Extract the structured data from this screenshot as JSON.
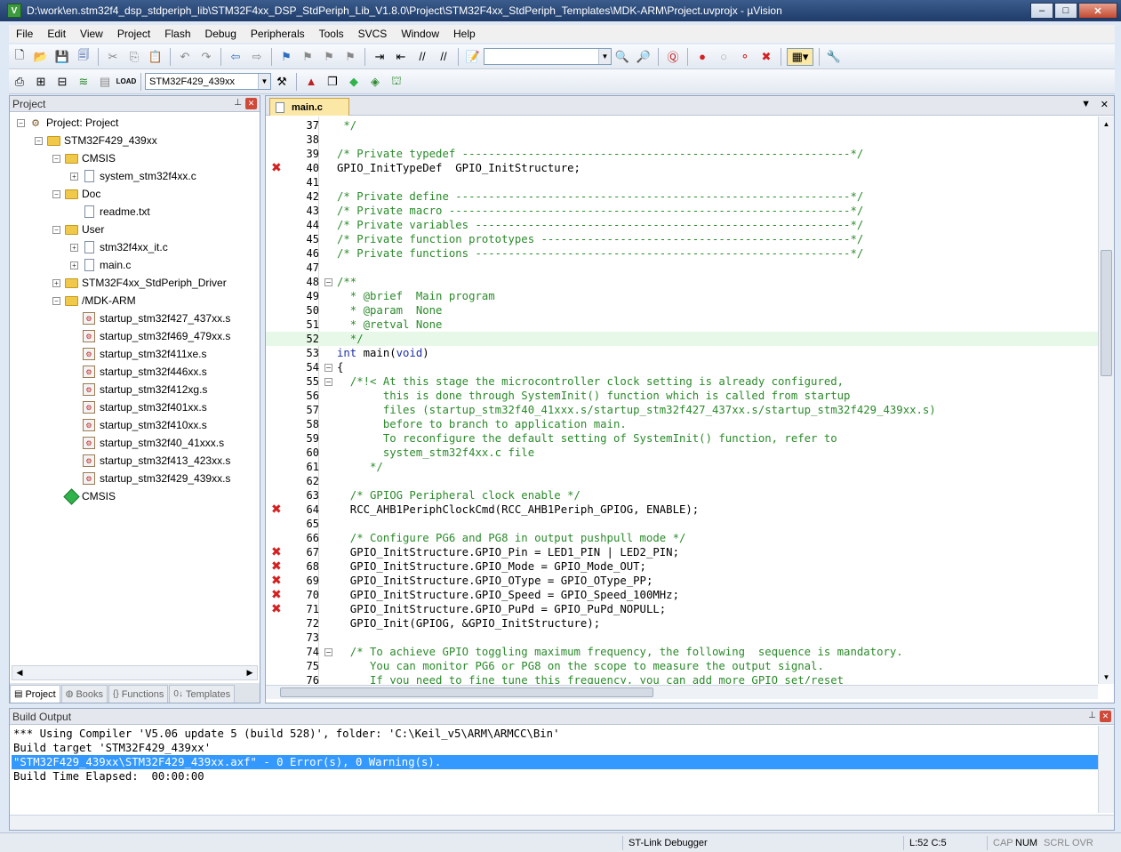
{
  "window": {
    "title": "D:\\work\\en.stm32f4_dsp_stdperiph_lib\\STM32F4xx_DSP_StdPeriph_Lib_V1.8.0\\Project\\STM32F4xx_StdPeriph_Templates\\MDK-ARM\\Project.uvprojx - µVision",
    "minimize": "–",
    "maximize": "□",
    "close": "✕"
  },
  "menu": [
    "File",
    "Edit",
    "View",
    "Project",
    "Flash",
    "Debug",
    "Peripherals",
    "Tools",
    "SVCS",
    "Window",
    "Help"
  ],
  "toolbar2": {
    "target_combo": "STM32F429_439xx",
    "load_label": "LOAD"
  },
  "project_panel": {
    "title": "Project",
    "pin": "📌",
    "close": "✕",
    "tree": [
      {
        "label": "Project: Project",
        "level": 0,
        "icon": "project-icon",
        "expander": "−"
      },
      {
        "label": "STM32F429_439xx",
        "level": 1,
        "icon": "folder-icon",
        "expander": "−"
      },
      {
        "label": "CMSIS",
        "level": 2,
        "icon": "folder-icon",
        "expander": "−"
      },
      {
        "label": "system_stm32f4xx.c",
        "level": 3,
        "icon": "file-icon",
        "expander": "+"
      },
      {
        "label": "Doc",
        "level": 2,
        "icon": "folder-icon",
        "expander": "−"
      },
      {
        "label": "readme.txt",
        "level": 3,
        "icon": "file-icon",
        "expander": ""
      },
      {
        "label": "User",
        "level": 2,
        "icon": "folder-icon",
        "expander": "−"
      },
      {
        "label": "stm32f4xx_it.c",
        "level": 3,
        "icon": "file-icon",
        "expander": "+"
      },
      {
        "label": "main.c",
        "level": 3,
        "icon": "file-icon",
        "expander": "+"
      },
      {
        "label": "STM32F4xx_StdPeriph_Driver",
        "level": 2,
        "icon": "folder-icon",
        "expander": "+"
      },
      {
        "label": "/MDK-ARM",
        "level": 2,
        "icon": "folder-icon",
        "expander": "−"
      },
      {
        "label": "startup_stm32f427_437xx.s",
        "level": 3,
        "icon": "asm-icon",
        "expander": ""
      },
      {
        "label": "startup_stm32f469_479xx.s",
        "level": 3,
        "icon": "asm-icon",
        "expander": ""
      },
      {
        "label": "startup_stm32f411xe.s",
        "level": 3,
        "icon": "asm-icon",
        "expander": ""
      },
      {
        "label": "startup_stm32f446xx.s",
        "level": 3,
        "icon": "asm-icon",
        "expander": ""
      },
      {
        "label": "startup_stm32f412xg.s",
        "level": 3,
        "icon": "asm-icon",
        "expander": ""
      },
      {
        "label": "startup_stm32f401xx.s",
        "level": 3,
        "icon": "asm-icon",
        "expander": ""
      },
      {
        "label": "startup_stm32f410xx.s",
        "level": 3,
        "icon": "asm-icon",
        "expander": ""
      },
      {
        "label": "startup_stm32f40_41xxx.s",
        "level": 3,
        "icon": "asm-icon",
        "expander": ""
      },
      {
        "label": "startup_stm32f413_423xx.s",
        "level": 3,
        "icon": "asm-icon",
        "expander": ""
      },
      {
        "label": "startup_stm32f429_439xx.s",
        "level": 3,
        "icon": "asm-icon",
        "expander": ""
      },
      {
        "label": "CMSIS",
        "level": 2,
        "icon": "cmsis-gem-icon",
        "expander": ""
      }
    ],
    "tabs": [
      {
        "label": "Project",
        "icon": "▤",
        "active": true
      },
      {
        "label": "Books",
        "icon": "◍",
        "active": false
      },
      {
        "label": "Functions",
        "icon": "{}",
        "active": false
      },
      {
        "label": "Templates",
        "icon": "0↓",
        "active": false
      }
    ]
  },
  "editor": {
    "tab_label": "main.c",
    "dropdown": "▼",
    "close": "✕",
    "lines": [
      {
        "n": "37",
        "text": " */",
        "type": "cmt",
        "err": false,
        "fold": ""
      },
      {
        "n": "38",
        "text": "",
        "type": "plain",
        "err": false,
        "fold": ""
      },
      {
        "n": "39",
        "text": "/* Private typedef -----------------------------------------------------------*/",
        "type": "cmt",
        "err": false,
        "fold": ""
      },
      {
        "n": "40",
        "text": "GPIO_InitTypeDef  GPIO_InitStructure;",
        "type": "plain",
        "err": true,
        "fold": ""
      },
      {
        "n": "41",
        "text": "",
        "type": "plain",
        "err": false,
        "fold": ""
      },
      {
        "n": "42",
        "text": "/* Private define ------------------------------------------------------------*/",
        "type": "cmt",
        "err": false,
        "fold": ""
      },
      {
        "n": "43",
        "text": "/* Private macro -------------------------------------------------------------*/",
        "type": "cmt",
        "err": false,
        "fold": ""
      },
      {
        "n": "44",
        "text": "/* Private variables ---------------------------------------------------------*/",
        "type": "cmt",
        "err": false,
        "fold": ""
      },
      {
        "n": "45",
        "text": "/* Private function prototypes -----------------------------------------------*/",
        "type": "cmt",
        "err": false,
        "fold": ""
      },
      {
        "n": "46",
        "text": "/* Private functions ---------------------------------------------------------*/",
        "type": "cmt",
        "err": false,
        "fold": ""
      },
      {
        "n": "47",
        "text": "",
        "type": "plain",
        "err": false,
        "fold": ""
      },
      {
        "n": "48",
        "text": "/**",
        "type": "cmt",
        "err": false,
        "fold": "−"
      },
      {
        "n": "49",
        "text": "  * @brief  Main program",
        "type": "cmt",
        "err": false,
        "fold": ""
      },
      {
        "n": "50",
        "text": "  * @param  None",
        "type": "cmt",
        "err": false,
        "fold": ""
      },
      {
        "n": "51",
        "text": "  * @retval None",
        "type": "cmt",
        "err": false,
        "fold": ""
      },
      {
        "n": "52",
        "text": "  */",
        "type": "cmt",
        "err": false,
        "fold": "",
        "current": true
      },
      {
        "n": "53",
        "text": "int main(void)",
        "type": "kw",
        "err": false,
        "fold": ""
      },
      {
        "n": "54",
        "text": "{",
        "type": "plain",
        "err": false,
        "fold": "−"
      },
      {
        "n": "55",
        "text": "  /*!< At this stage the microcontroller clock setting is already configured,",
        "type": "cmt",
        "err": false,
        "fold": "−"
      },
      {
        "n": "56",
        "text": "       this is done through SystemInit() function which is called from startup",
        "type": "cmt",
        "err": false,
        "fold": ""
      },
      {
        "n": "57",
        "text": "       files (startup_stm32f40_41xxx.s/startup_stm32f427_437xx.s/startup_stm32f429_439xx.s)",
        "type": "cmt",
        "err": false,
        "fold": ""
      },
      {
        "n": "58",
        "text": "       before to branch to application main.",
        "type": "cmt",
        "err": false,
        "fold": ""
      },
      {
        "n": "59",
        "text": "       To reconfigure the default setting of SystemInit() function, refer to",
        "type": "cmt",
        "err": false,
        "fold": ""
      },
      {
        "n": "60",
        "text": "       system_stm32f4xx.c file",
        "type": "cmt",
        "err": false,
        "fold": ""
      },
      {
        "n": "61",
        "text": "     */",
        "type": "cmt",
        "err": false,
        "fold": ""
      },
      {
        "n": "62",
        "text": "",
        "type": "plain",
        "err": false,
        "fold": ""
      },
      {
        "n": "63",
        "text": "  /* GPIOG Peripheral clock enable */",
        "type": "cmt",
        "err": false,
        "fold": ""
      },
      {
        "n": "64",
        "text": "  RCC_AHB1PeriphClockCmd(RCC_AHB1Periph_GPIOG, ENABLE);",
        "type": "plain",
        "err": true,
        "fold": ""
      },
      {
        "n": "65",
        "text": "",
        "type": "plain",
        "err": false,
        "fold": ""
      },
      {
        "n": "66",
        "text": "  /* Configure PG6 and PG8 in output pushpull mode */",
        "type": "cmt",
        "err": false,
        "fold": ""
      },
      {
        "n": "67",
        "text": "  GPIO_InitStructure.GPIO_Pin = LED1_PIN | LED2_PIN;",
        "type": "plain",
        "err": true,
        "fold": ""
      },
      {
        "n": "68",
        "text": "  GPIO_InitStructure.GPIO_Mode = GPIO_Mode_OUT;",
        "type": "plain",
        "err": true,
        "fold": ""
      },
      {
        "n": "69",
        "text": "  GPIO_InitStructure.GPIO_OType = GPIO_OType_PP;",
        "type": "plain",
        "err": true,
        "fold": ""
      },
      {
        "n": "70",
        "text": "  GPIO_InitStructure.GPIO_Speed = GPIO_Speed_100MHz;",
        "type": "plain",
        "err": true,
        "fold": ""
      },
      {
        "n": "71",
        "text": "  GPIO_InitStructure.GPIO_PuPd = GPIO_PuPd_NOPULL;",
        "type": "plain",
        "err": true,
        "fold": ""
      },
      {
        "n": "72",
        "text": "  GPIO_Init(GPIOG, &GPIO_InitStructure);",
        "type": "plain",
        "err": false,
        "fold": ""
      },
      {
        "n": "73",
        "text": "",
        "type": "plain",
        "err": false,
        "fold": ""
      },
      {
        "n": "74",
        "text": "  /* To achieve GPIO toggling maximum frequency, the following  sequence is mandatory.",
        "type": "cmt",
        "err": false,
        "fold": "−"
      },
      {
        "n": "75",
        "text": "     You can monitor PG6 or PG8 on the scope to measure the output signal.",
        "type": "cmt",
        "err": false,
        "fold": ""
      },
      {
        "n": "76",
        "text": "     If you need to fine tune this frequency, you can add more GPIO set/reset",
        "type": "cmt",
        "err": false,
        "fold": ""
      }
    ],
    "error_mark": "✖"
  },
  "build_output": {
    "title": "Build Output",
    "lines": [
      {
        "text": "*** Using Compiler 'V5.06 update 5 (build 528)', folder: 'C:\\Keil_v5\\ARM\\ARMCC\\Bin'",
        "selected": false
      },
      {
        "text": "Build target 'STM32F429_439xx'",
        "selected": false
      },
      {
        "text": "\"STM32F429_439xx\\STM32F429_439xx.axf\" - 0 Error(s), 0 Warning(s).",
        "selected": true
      },
      {
        "text": "Build Time Elapsed:  00:00:00",
        "selected": false
      }
    ]
  },
  "status_bar": {
    "debugger": "ST-Link Debugger",
    "position": "L:52 C:5",
    "cap": "CAP",
    "num": "NUM",
    "scrl": "SCRL",
    "ovr": "OVR"
  },
  "colors": {
    "comment": "#2a8a2a",
    "keyword": "#1d2fa8",
    "error": "#d42020",
    "selection": "#3399ff"
  }
}
